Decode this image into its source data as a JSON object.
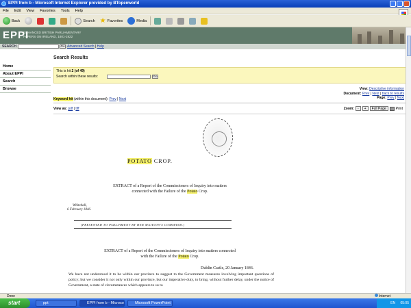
{
  "window": {
    "title": "EPPI from b - Microsoft Internet Explorer provided by BTopenworld"
  },
  "menu": [
    "File",
    "Edit",
    "View",
    "Favorites",
    "Tools",
    "Help"
  ],
  "toolbar": {
    "back": "Back",
    "search": "Search",
    "favorites": "Favorites",
    "media": "Media"
  },
  "banner": {
    "logo": "EPPI",
    "subtitle_line1": "ENHANCED BRITISH PARLIAMENTARY",
    "subtitle_line2": "PAPERS ON IRELAND, 1801-1922"
  },
  "searchbar": {
    "label": "SEARCH",
    "go": "Go",
    "advanced": "Advanced Search",
    "separator": "|",
    "help": "Help"
  },
  "sidebar": {
    "items": [
      "Home",
      "About EPPI",
      "Search",
      "Browse"
    ]
  },
  "results": {
    "heading": "Search Results",
    "hit_prefix": "This is hit",
    "hit_number": "2",
    "hit_of": "(of 49)",
    "within_label": "Search within these results:",
    "go": "Go"
  },
  "viewinfo": {
    "view_label": "View:",
    "view_link": "Descriptive information",
    "document_label": "Document:",
    "prev": "Prev",
    "next": "Next",
    "back_to_results": "back to results",
    "page_label": "Page:",
    "sep": "|"
  },
  "keyword": {
    "label": "Keyword hit",
    "within": "(within this document):",
    "prev": "Prev",
    "next": "Next",
    "sep": "|"
  },
  "viewas": {
    "label": "View as:",
    "pdf": "pdf",
    "tiff": "tiff",
    "sep": "|"
  },
  "zoom": {
    "label": "Zoom:",
    "minus": "-",
    "plus": "+",
    "full_page": "Full Page",
    "print": "Print"
  },
  "document": {
    "title_hl": "POTATO",
    "title_rest": "CROP.",
    "extract1_a": "EXTRACT of a Report of the Commissioners of Inquiry into matters",
    "extract1_b": "connected with the Failure of the",
    "extract1_hl": "Potato",
    "extract1_c": "Crop.",
    "place1": "Whitehall,",
    "date1": "6 February 1846.",
    "presented": "(PRESENTED TO PARLIAMENT BY HER MAJESTY'S COMMAND.)",
    "extract2_a": "EXTRACT of a Report of the Commissioners of Inquiry into matters connected",
    "extract2_b": "with the Failure of the",
    "extract2_hl": "Potato",
    "extract2_c": "Crop.",
    "place2": "Dublin Castle, 20 January 1846.",
    "body": "We have not understood it to be within our province to suggest to the Government measures involving important questions of policy; but we consider it not only within our province, but our imperative duty, to bring, without further delay, under the notice of Government, a state of circumstances which appears to us to"
  },
  "status": {
    "left": "Done",
    "zone": "Internet"
  },
  "taskbar": {
    "start": "start",
    "tasks": [
      "ppt",
      "EPPI from b - Microso...",
      "Microsoft PowerPoint ..."
    ],
    "lang": "EN",
    "clock": "05:05"
  }
}
